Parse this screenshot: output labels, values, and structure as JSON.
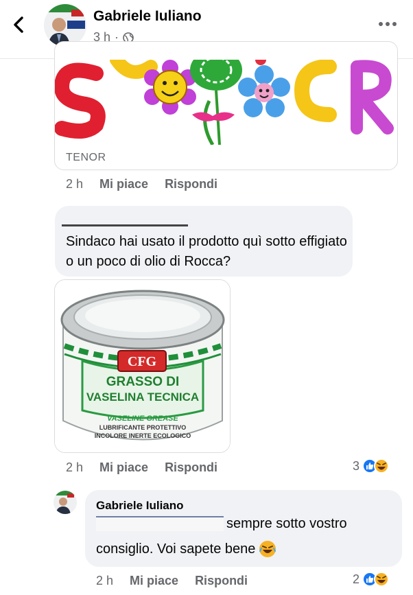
{
  "header": {
    "author_name": "Gabriele Iuliano",
    "time": "3 h",
    "time_separator": "·",
    "privacy_icon": "globe-icon",
    "back_icon": "chevron-left-icon",
    "more_icon": "more-horizontal-icon"
  },
  "gif_comment": {
    "provider": "TENOR",
    "actions": {
      "time": "2 h",
      "like": "Mi piace",
      "reply": "Rispondi"
    }
  },
  "comment1": {
    "text": "Sindaco hai usato il prodotto quì sotto effigiato o un poco di olio di Rocca?",
    "photo": {
      "brand": "CFG",
      "title_line1": "GRASSO DI",
      "title_line2": "VASELINA TECNICA",
      "subtitle": "VASELINE GREASE",
      "desc_line1": "LUBRIFICANTE PROTETTIVO",
      "desc_line2": "INCOLORE INERTE ECOLOGICO"
    },
    "actions": {
      "time": "2 h",
      "like": "Mi piace",
      "reply": "Rispondi"
    },
    "reaction_count": "3"
  },
  "reply": {
    "author_name": "Gabriele Iuliano",
    "text_line1": "sempre sotto vostro",
    "text_line2": "consiglio. Voi sapete bene",
    "emoji": "laughing-emoji",
    "actions": {
      "time": "2 h",
      "like": "Mi piace",
      "reply": "Rispondi"
    },
    "reaction_count": "2"
  },
  "colors": {
    "like_blue": "#1877f2",
    "haha_yellow": "#f7b125",
    "bubble_bg": "#f0f2f5",
    "secondary_text": "#65676b"
  }
}
